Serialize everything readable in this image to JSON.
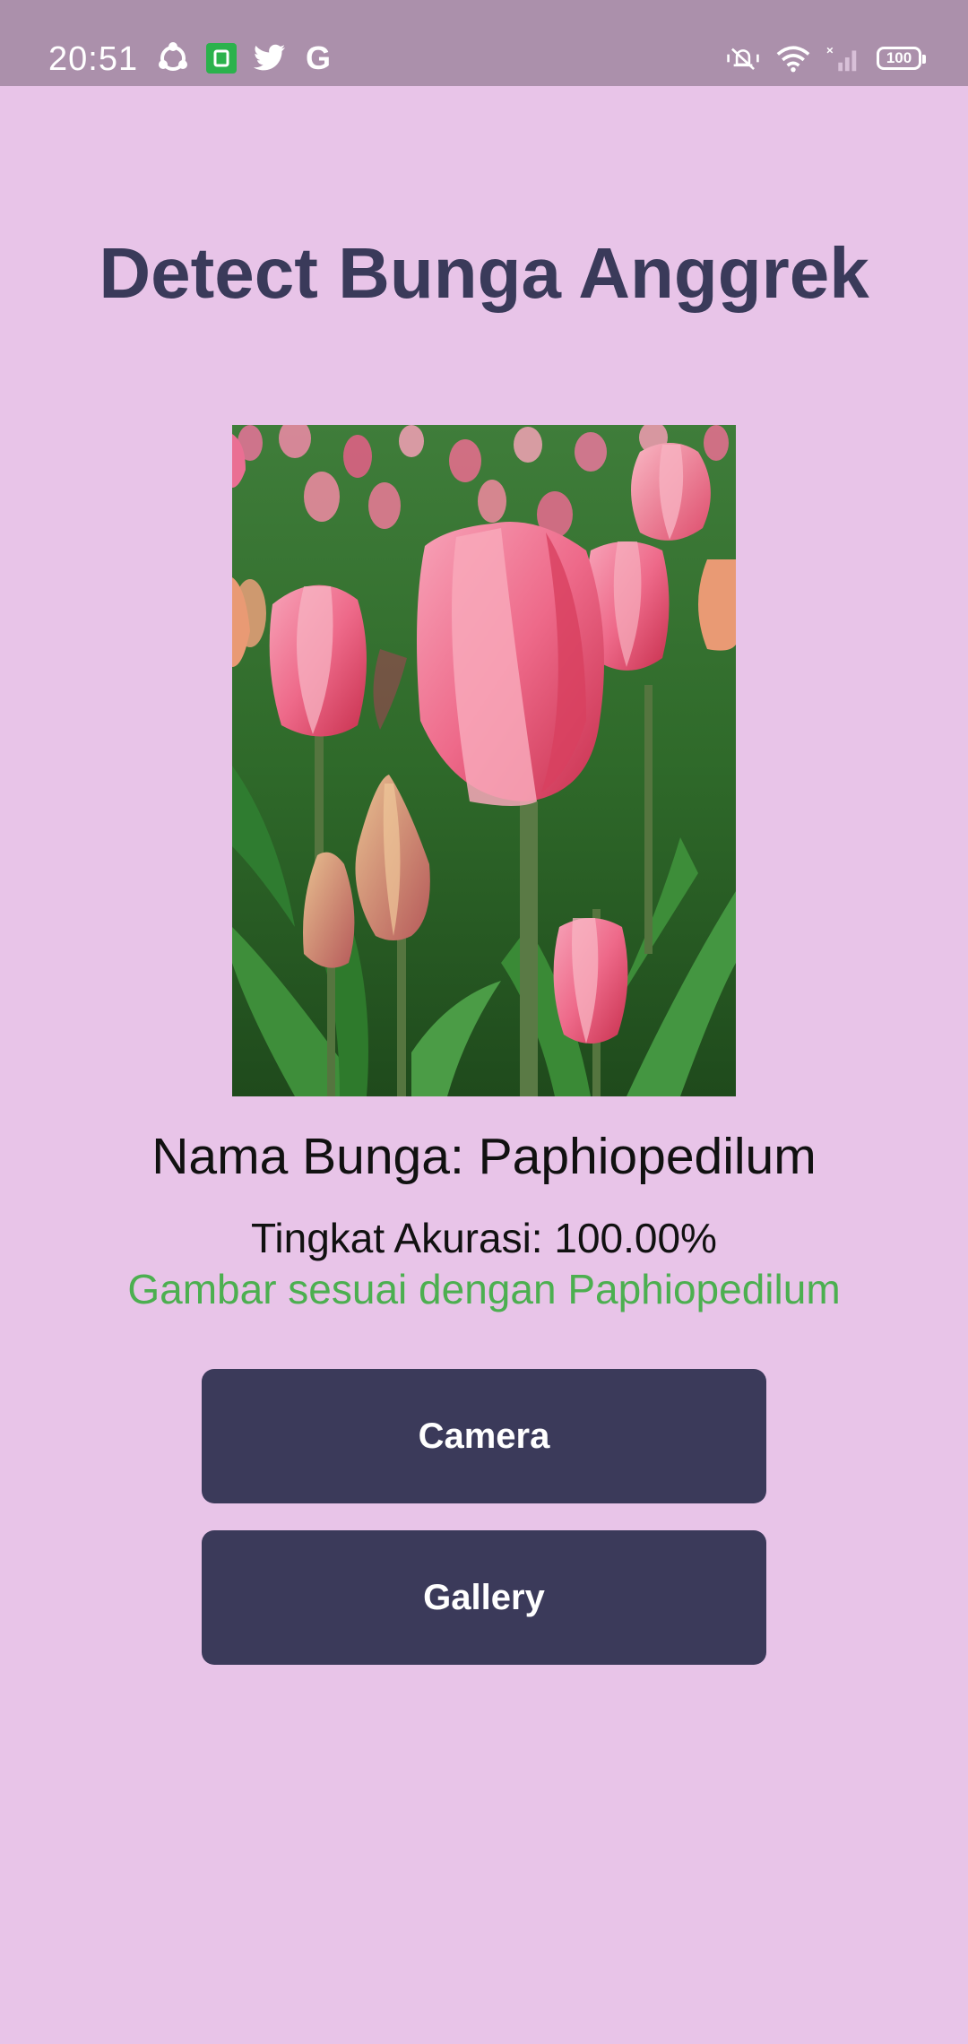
{
  "status_bar": {
    "time": "20:51",
    "battery": "100",
    "left_icons": [
      "sync-icon",
      "app-store-icon",
      "twitter-icon",
      "google-icon"
    ],
    "right_icons": [
      "mute-vibrate-icon",
      "wifi-icon",
      "signal-icon",
      "battery-icon"
    ],
    "google_glyph": "G"
  },
  "app": {
    "title": "Detect Bunga Anggrek",
    "flower_name": "Nama Bunga: Paphiopedilum",
    "accuracy": "Tingkat Akurasi: 100.00%",
    "match_message": "Gambar sesuai dengan Paphiopedilum",
    "camera_label": "Camera",
    "gallery_label": "Gallery"
  },
  "colors": {
    "background": "#e8c4e8",
    "status_bar": "#ab90ab",
    "title": "#3a3a5a",
    "button": "#3b3a5a",
    "match_text": "#4caf50"
  }
}
